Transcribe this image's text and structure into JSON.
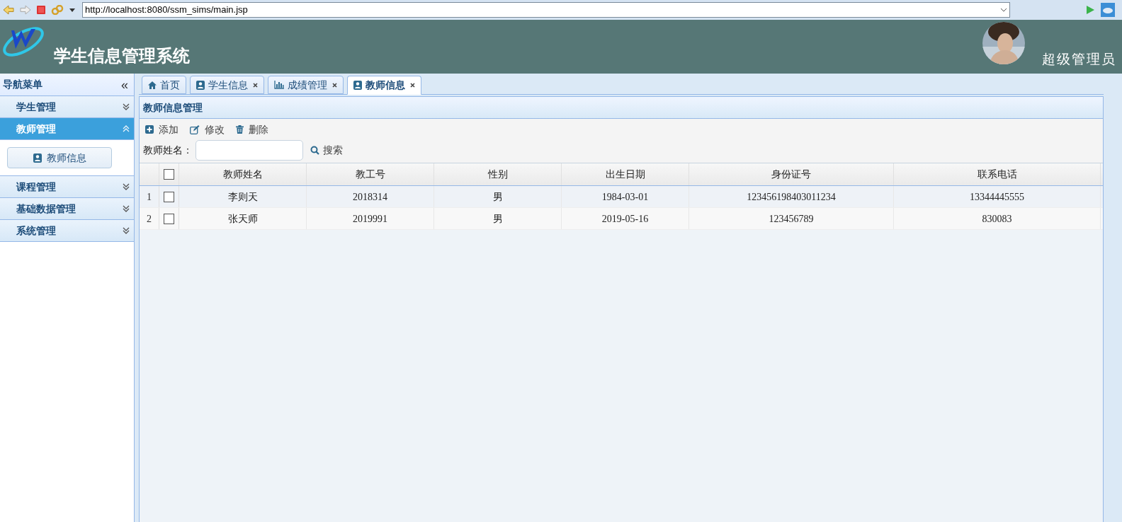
{
  "browser": {
    "url": "http://localhost:8080/ssm_sims/main.jsp"
  },
  "header": {
    "title": "学生信息管理系统",
    "user": "超级管理员"
  },
  "sidebar": {
    "title": "导航菜单",
    "collapse": "«",
    "groups": [
      {
        "label": "学生管理",
        "expanded": false,
        "selected": false
      },
      {
        "label": "教师管理",
        "expanded": true,
        "selected": true,
        "children": [
          {
            "label": "教师信息"
          }
        ]
      },
      {
        "label": "课程管理",
        "expanded": false,
        "selected": false
      },
      {
        "label": "基础数据管理",
        "expanded": false,
        "selected": false
      },
      {
        "label": "系统管理",
        "expanded": false,
        "selected": false
      }
    ]
  },
  "tabs": [
    {
      "label": "首页",
      "kind": "home",
      "closable": false,
      "selected": false
    },
    {
      "label": "学生信息",
      "kind": "user",
      "closable": true,
      "selected": false
    },
    {
      "label": "成绩管理",
      "kind": "chart",
      "closable": true,
      "selected": false
    },
    {
      "label": "教师信息",
      "kind": "user",
      "closable": true,
      "selected": true
    }
  ],
  "panel": {
    "title": "教师信息管理",
    "toolbar": [
      {
        "label": "添加",
        "kind": "plus"
      },
      {
        "label": "修改",
        "kind": "edit"
      },
      {
        "label": "删除",
        "kind": "trash"
      }
    ],
    "search": {
      "label": "教师姓名：",
      "button": "搜索"
    },
    "table": {
      "header_checked": false,
      "columns": [
        "教师姓名",
        "教工号",
        "性别",
        "出生日期",
        "身份证号",
        "联系电话"
      ],
      "rows": [
        {
          "index": "1",
          "checked": false,
          "cells": [
            "李则天",
            "2018314",
            "男",
            "1984-03-01",
            "123456198403011234",
            "13344445555"
          ]
        },
        {
          "index": "2",
          "checked": false,
          "cells": [
            "张天师",
            "2019991",
            "男",
            "2019-05-16",
            "123456789",
            "830083"
          ]
        }
      ]
    }
  }
}
